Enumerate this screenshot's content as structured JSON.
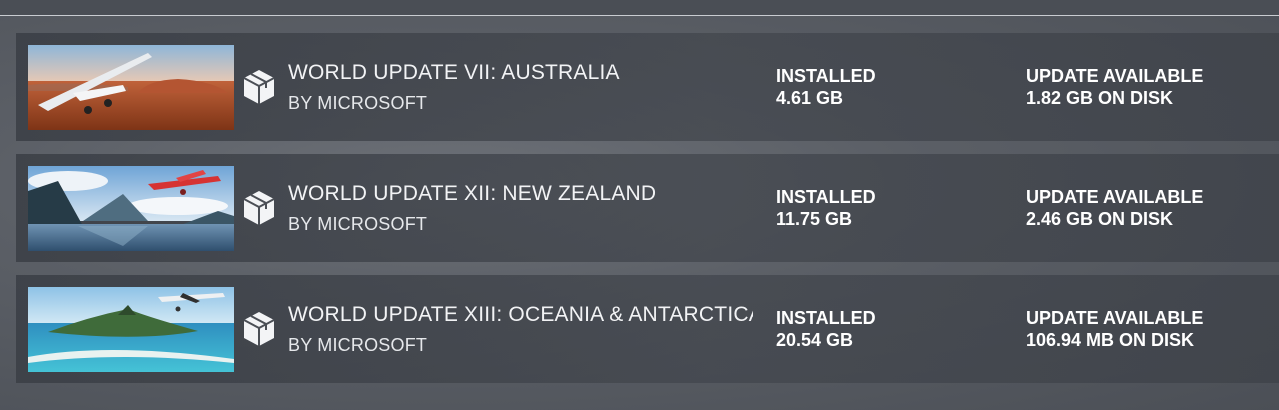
{
  "items": [
    {
      "title": "WORLD UPDATE VII: AUSTRALIA",
      "publisher": "BY MICROSOFT",
      "status_label": "INSTALLED",
      "installed_size": "4.61 GB",
      "update_label": "UPDATE AVAILABLE",
      "update_size": "1.82 GB ON DISK",
      "thumbnail": "australia-outback-plane-image",
      "icon": "package-icon"
    },
    {
      "title": "WORLD UPDATE XII: NEW ZEALAND",
      "publisher": "BY MICROSOFT",
      "status_label": "INSTALLED",
      "installed_size": "11.75 GB",
      "update_label": "UPDATE AVAILABLE",
      "update_size": "2.46 GB ON DISK",
      "thumbnail": "new-zealand-fjord-plane-image",
      "icon": "package-icon"
    },
    {
      "title": "WORLD UPDATE XIII: OCEANIA & ANTARCTICA",
      "publisher": "BY MICROSOFT",
      "status_label": "INSTALLED",
      "installed_size": "20.54 GB",
      "update_label": "UPDATE AVAILABLE",
      "update_size": "106.94 MB ON DISK",
      "thumbnail": "oceania-island-plane-image",
      "icon": "package-icon"
    }
  ]
}
